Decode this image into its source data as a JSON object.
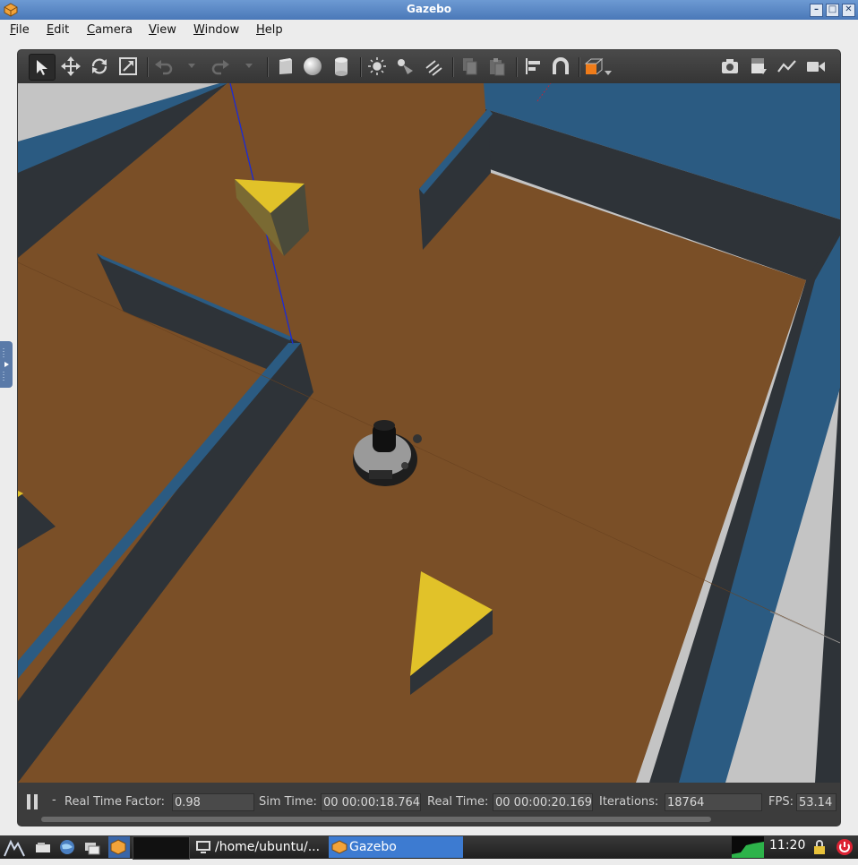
{
  "window": {
    "title": "Gazebo",
    "buttons": [
      "–",
      "□",
      "✕"
    ]
  },
  "menu": [
    {
      "label": "File",
      "key": "F",
      "rest": "ile"
    },
    {
      "label": "Edit",
      "key": "E",
      "rest": "dit"
    },
    {
      "label": "Camera",
      "key": "C",
      "rest": "amera"
    },
    {
      "label": "View",
      "key": "V",
      "rest": "iew"
    },
    {
      "label": "Window",
      "key": "W",
      "rest": "indow"
    },
    {
      "label": "Help",
      "key": "H",
      "rest": "elp"
    }
  ],
  "toolbar": {
    "tools": [
      "select-arrow-icon",
      "translate-icon",
      "rotate-icon",
      "scale-icon",
      "undo-icon",
      "redo-icon",
      "box-shape-icon",
      "sphere-shape-icon",
      "cylinder-shape-icon",
      "point-light-icon",
      "spot-light-icon",
      "directional-light-icon",
      "copy-icon",
      "paste-icon",
      "align-icon",
      "snap-icon",
      "view-angle-icon",
      "screenshot-icon",
      "log-icon",
      "plot-icon",
      "video-record-icon"
    ],
    "active_tool": "select-arrow-icon"
  },
  "bottombar": {
    "real_time_factor_label": "Real Time Factor:",
    "real_time_factor": "0.98",
    "sim_time_label": "Sim Time:",
    "sim_time": "00 00:00:18.764",
    "real_time_label": "Real Time:",
    "real_time": "00 00:00:20.169",
    "iterations_label": "Iterations:",
    "iterations": "18764",
    "fps_label": "FPS:",
    "fps": "53.14",
    "step_marker": "-"
  },
  "taskbar": {
    "terminal_task": "/home/ubuntu/...",
    "gazebo_task": "Gazebo",
    "clock": "11:20"
  },
  "colors": {
    "floor": "#7a4f27",
    "wall_top": "#2d5a80",
    "wall_side": "#2f3338",
    "cheese": "#e1c229",
    "titlebar": "#4a78b8"
  }
}
